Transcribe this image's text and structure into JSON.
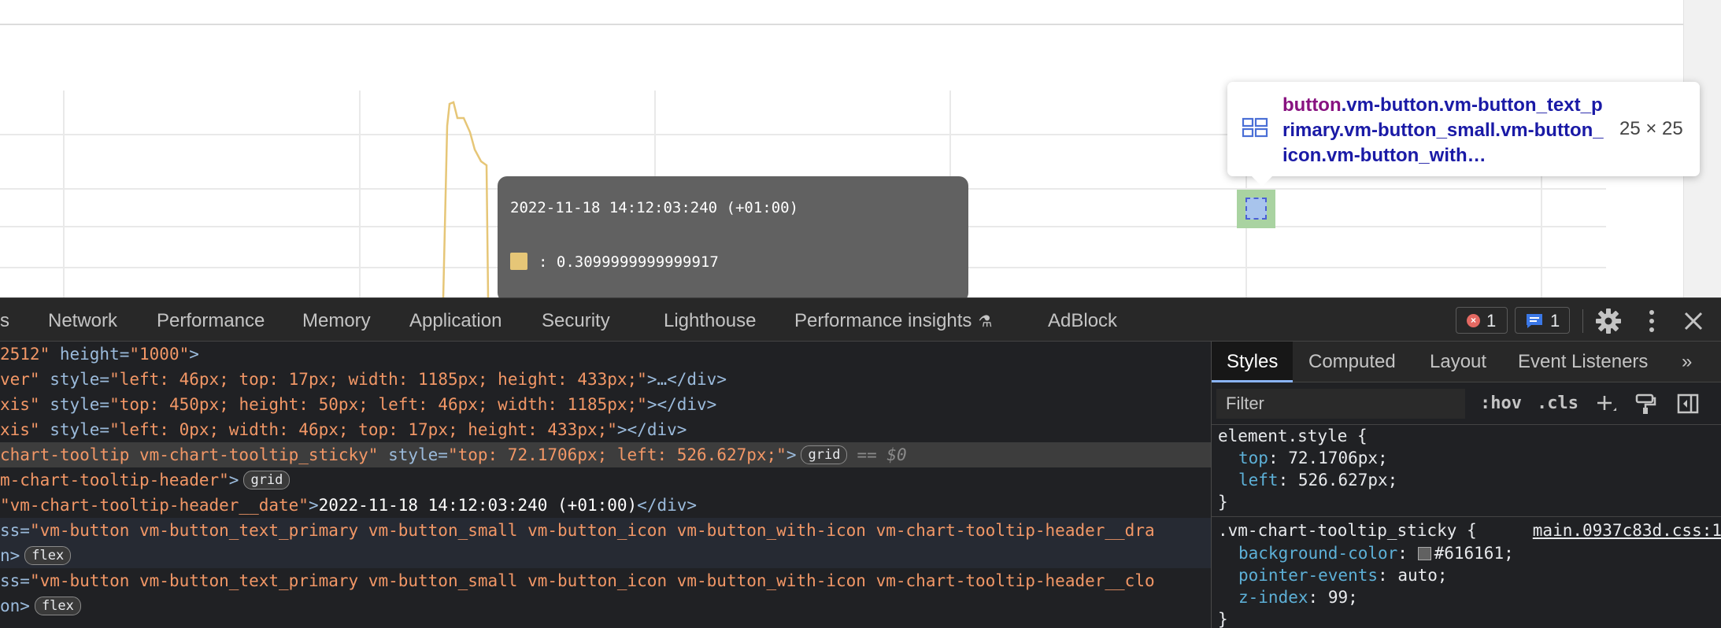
{
  "chart": {
    "tooltip_date": "2022-11-18 14:12:03:240 (+01:00)",
    "tooltip_value": ": 0.3099999999999917",
    "series_color": "#e6c677",
    "tooltip_bg": "#616161"
  },
  "inspect_tooltip": {
    "tag": "button",
    "classes": ".vm-button.vm-button_text_primary.vm-button_small.vm-button_icon.vm-button_with…",
    "size": "25 × 25"
  },
  "devtools": {
    "tabs": [
      "s",
      "Network",
      "Performance",
      "Memory",
      "Application",
      "Security",
      "Lighthouse",
      "Performance insights",
      "AdBlock"
    ],
    "error_count": "1",
    "message_count": "1"
  },
  "elements": {
    "line0": {
      "a": "2512\"",
      "b": " height=",
      "c": "\"1000\"",
      "d": ">"
    },
    "line1": {
      "a": "ver\"",
      "b": " style=",
      "c": "\"left: 46px; top: 17px; width: 1185px; height: 433px;\"",
      "d": ">…</div>"
    },
    "line2": {
      "a": "xis\"",
      "b": " style=",
      "c": "\"top: 450px; height: 50px; left: 46px; width: 1185px;\"",
      "d": "></div>"
    },
    "line3": {
      "a": "xis\"",
      "b": " style=",
      "c": "\"left: 0px; width: 46px; top: 17px; height: 433px;\"",
      "d": "></div>"
    },
    "line4": {
      "a": "chart-tooltip vm-chart-tooltip_sticky\"",
      "b": " style=",
      "c": "\"top: 72.1706px; left: 526.627px;\"",
      "d": ">",
      "pill": "grid",
      "dollar": "== $0"
    },
    "line5": {
      "a": "m-chart-tooltip-header\"",
      "d": ">",
      "pill": "grid"
    },
    "line6": {
      "a": "\"vm-chart-tooltip-header__date\"",
      "d": ">",
      "text": "2022-11-18 14:12:03:240 (+01:00)",
      "e": "</div>"
    },
    "line7": {
      "a": "ss=",
      "c": "\"vm-button vm-button_text_primary vm-button_small vm-button_icon vm-button_with-icon vm-chart-tooltip-header__dra"
    },
    "line8": {
      "a": "n>",
      "pill": "flex"
    },
    "line9": {
      "a": "ss=",
      "c": "\"vm-button vm-button_text_primary vm-button_small vm-button_icon vm-button_with-icon vm-chart-tooltip-header__clo"
    },
    "line10": {
      "a": "on>",
      "pill": "flex"
    }
  },
  "styles_pane": {
    "tabs": [
      "Styles",
      "Computed",
      "Layout",
      "Event Listeners",
      "»"
    ],
    "filter_placeholder": "Filter",
    "hov": ":hov",
    "cls": ".cls",
    "rule1": {
      "selector": "element.style {",
      "props": [
        {
          "name": "top",
          "value": "72.1706px;"
        },
        {
          "name": "left",
          "value": "526.627px;"
        }
      ],
      "close": "}"
    },
    "rule2": {
      "selector": ".vm-chart-tooltip_sticky {",
      "source": "main.0937c83d.css:1",
      "props": [
        {
          "name": "background-color",
          "value": "#616161;"
        },
        {
          "name": "pointer-events",
          "value": "auto;"
        },
        {
          "name": "z-index",
          "value": "99;"
        }
      ],
      "close": "}"
    }
  }
}
